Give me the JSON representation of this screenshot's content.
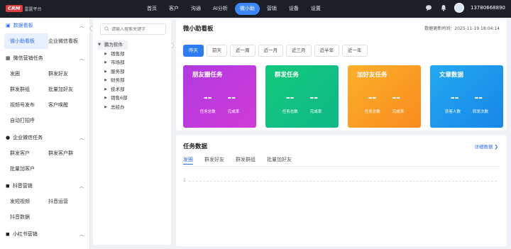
{
  "app": {
    "logo_text": "CRM",
    "logo_sub": "雷霆平台"
  },
  "nav": {
    "items": [
      "首页",
      "客户",
      "沟通",
      "AI分析",
      "微小助",
      "营销",
      "设备",
      "设置"
    ],
    "active_index": 4
  },
  "user": {
    "phone": "13780668890"
  },
  "sidebar": {
    "sections": [
      {
        "title": "数据看板",
        "highlight": true,
        "items": [
          "微小助看板",
          "企业微信看板"
        ],
        "selected": "微小助看板"
      },
      {
        "title": "微信营销任务",
        "items": [
          "发圈",
          "群发好友",
          "群发群组",
          "批量加好友",
          "视频号发布",
          "客户唤醒",
          "自动打招呼"
        ]
      },
      {
        "title": "企业微信任务",
        "items": [
          "群发客户",
          "群发客户群",
          "批量加客户"
        ]
      },
      {
        "title": "抖音营销",
        "items": [
          "发短视频",
          "抖音运营",
          "抖音数据"
        ]
      },
      {
        "title": "小红书营销",
        "items": []
      }
    ]
  },
  "tree": {
    "search_placeholder": "请输入搜索关键字",
    "root": "鹏为软件",
    "children": [
      "销售部",
      "市场部",
      "服务部",
      "财务部",
      "技术部",
      "销售6部",
      "总经办"
    ]
  },
  "dashboard": {
    "title": "微小助看板",
    "update_label": "数据更新时间：2025-11-19 18:04:14",
    "time_tabs": [
      "昨天",
      "前天",
      "近一周",
      "近一月",
      "近三月",
      "近半年",
      "近一年"
    ],
    "active_tab": 0,
    "cards": [
      {
        "title": "朋友圈任务",
        "v1": "--",
        "v2": "--",
        "l1": "任务总数",
        "l2": "完成率",
        "color": "#c03adc"
      },
      {
        "title": "群发任务",
        "v1": "--",
        "v2": "--",
        "l1": "任务总数",
        "l2": "完成率",
        "color": "#11c283"
      },
      {
        "title": "加好友任务",
        "v1": "--",
        "v2": "--",
        "l1": "任务总数",
        "l2": "完成率",
        "color": "#faa025"
      },
      {
        "title": "文章数据",
        "v1": "--",
        "v2": "--",
        "l1": "获客人数",
        "l2": "转发次数",
        "color": "#1f98ec"
      }
    ]
  },
  "task_data": {
    "title": "任务数据",
    "detail_link": "详细数据 ❯",
    "tabs": [
      "发圈",
      "群发好友",
      "群发群组",
      "批量加好友"
    ],
    "active_tab": 0,
    "axis_value": "1"
  }
}
